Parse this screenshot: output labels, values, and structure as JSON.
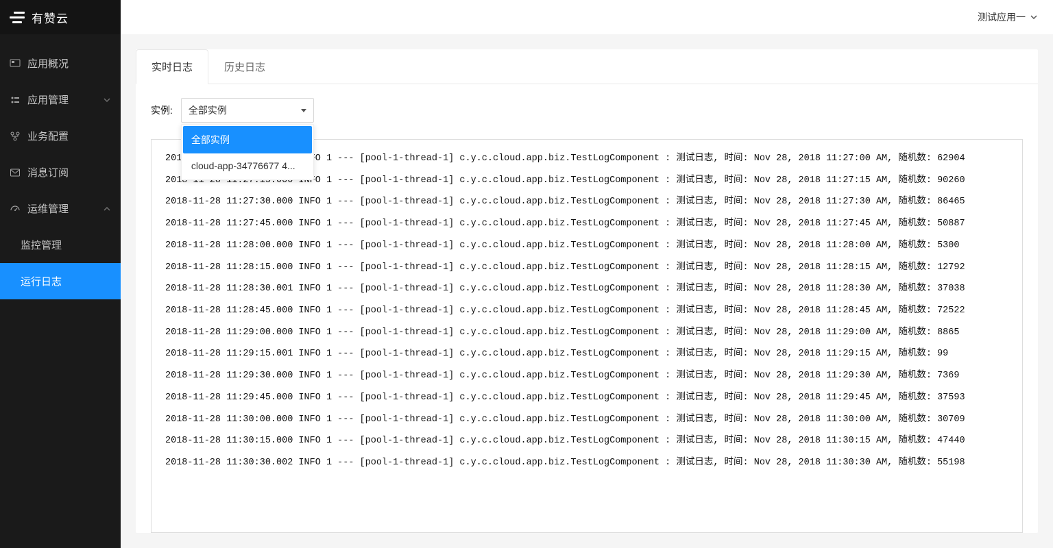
{
  "brand": "有赞云",
  "topbar": {
    "app_selector": "测试应用一"
  },
  "sidebar": {
    "items": [
      {
        "label": "应用概况",
        "icon": "overview",
        "hasCaret": false,
        "expanded": false
      },
      {
        "label": "应用管理",
        "icon": "manage",
        "hasCaret": true,
        "expanded": false
      },
      {
        "label": "业务配置",
        "icon": "config",
        "hasCaret": false,
        "expanded": false
      },
      {
        "label": "消息订阅",
        "icon": "message",
        "hasCaret": false,
        "expanded": false
      },
      {
        "label": "运维管理",
        "icon": "ops",
        "hasCaret": true,
        "expanded": true,
        "children": [
          {
            "label": "监控管理",
            "active": false
          },
          {
            "label": "运行日志",
            "active": true
          }
        ]
      }
    ]
  },
  "tabs": [
    {
      "label": "实时日志",
      "active": true
    },
    {
      "label": "历史日志",
      "active": false
    }
  ],
  "filter": {
    "label": "实例:",
    "selected": "全部实例",
    "options": [
      "全部实例",
      "cloud-app-34776677 4..."
    ]
  },
  "logs": [
    "2018-11-28 11:27:00.000 INFO 1 --- [pool-1-thread-1] c.y.c.cloud.app.biz.TestLogComponent : 测试日志, 时间: Nov 28, 2018 11:27:00 AM, 随机数: 62904",
    "2018-11-28 11:27:15.000 INFO 1 --- [pool-1-thread-1] c.y.c.cloud.app.biz.TestLogComponent : 测试日志, 时间: Nov 28, 2018 11:27:15 AM, 随机数: 90260",
    "2018-11-28 11:27:30.000 INFO 1 --- [pool-1-thread-1] c.y.c.cloud.app.biz.TestLogComponent : 测试日志, 时间: Nov 28, 2018 11:27:30 AM, 随机数: 86465",
    "2018-11-28 11:27:45.000 INFO 1 --- [pool-1-thread-1] c.y.c.cloud.app.biz.TestLogComponent : 测试日志, 时间: Nov 28, 2018 11:27:45 AM, 随机数: 50887",
    "2018-11-28 11:28:00.000 INFO 1 --- [pool-1-thread-1] c.y.c.cloud.app.biz.TestLogComponent : 测试日志, 时间: Nov 28, 2018 11:28:00 AM, 随机数: 5300",
    "2018-11-28 11:28:15.000 INFO 1 --- [pool-1-thread-1] c.y.c.cloud.app.biz.TestLogComponent : 测试日志, 时间: Nov 28, 2018 11:28:15 AM, 随机数: 12792",
    "2018-11-28 11:28:30.001 INFO 1 --- [pool-1-thread-1] c.y.c.cloud.app.biz.TestLogComponent : 测试日志, 时间: Nov 28, 2018 11:28:30 AM, 随机数: 37038",
    "2018-11-28 11:28:45.000 INFO 1 --- [pool-1-thread-1] c.y.c.cloud.app.biz.TestLogComponent : 测试日志, 时间: Nov 28, 2018 11:28:45 AM, 随机数: 72522",
    "2018-11-28 11:29:00.000 INFO 1 --- [pool-1-thread-1] c.y.c.cloud.app.biz.TestLogComponent : 测试日志, 时间: Nov 28, 2018 11:29:00 AM, 随机数: 8865",
    "2018-11-28 11:29:15.001 INFO 1 --- [pool-1-thread-1] c.y.c.cloud.app.biz.TestLogComponent : 测试日志, 时间: Nov 28, 2018 11:29:15 AM, 随机数: 99",
    "2018-11-28 11:29:30.000 INFO 1 --- [pool-1-thread-1] c.y.c.cloud.app.biz.TestLogComponent : 测试日志, 时间: Nov 28, 2018 11:29:30 AM, 随机数: 7369",
    "2018-11-28 11:29:45.000 INFO 1 --- [pool-1-thread-1] c.y.c.cloud.app.biz.TestLogComponent : 测试日志, 时间: Nov 28, 2018 11:29:45 AM, 随机数: 37593",
    "2018-11-28 11:30:00.000 INFO 1 --- [pool-1-thread-1] c.y.c.cloud.app.biz.TestLogComponent : 测试日志, 时间: Nov 28, 2018 11:30:00 AM, 随机数: 30709",
    "2018-11-28 11:30:15.000 INFO 1 --- [pool-1-thread-1] c.y.c.cloud.app.biz.TestLogComponent : 测试日志, 时间: Nov 28, 2018 11:30:15 AM, 随机数: 47440",
    "2018-11-28 11:30:30.002 INFO 1 --- [pool-1-thread-1] c.y.c.cloud.app.biz.TestLogComponent : 测试日志, 时间: Nov 28, 2018 11:30:30 AM, 随机数: 55198"
  ]
}
